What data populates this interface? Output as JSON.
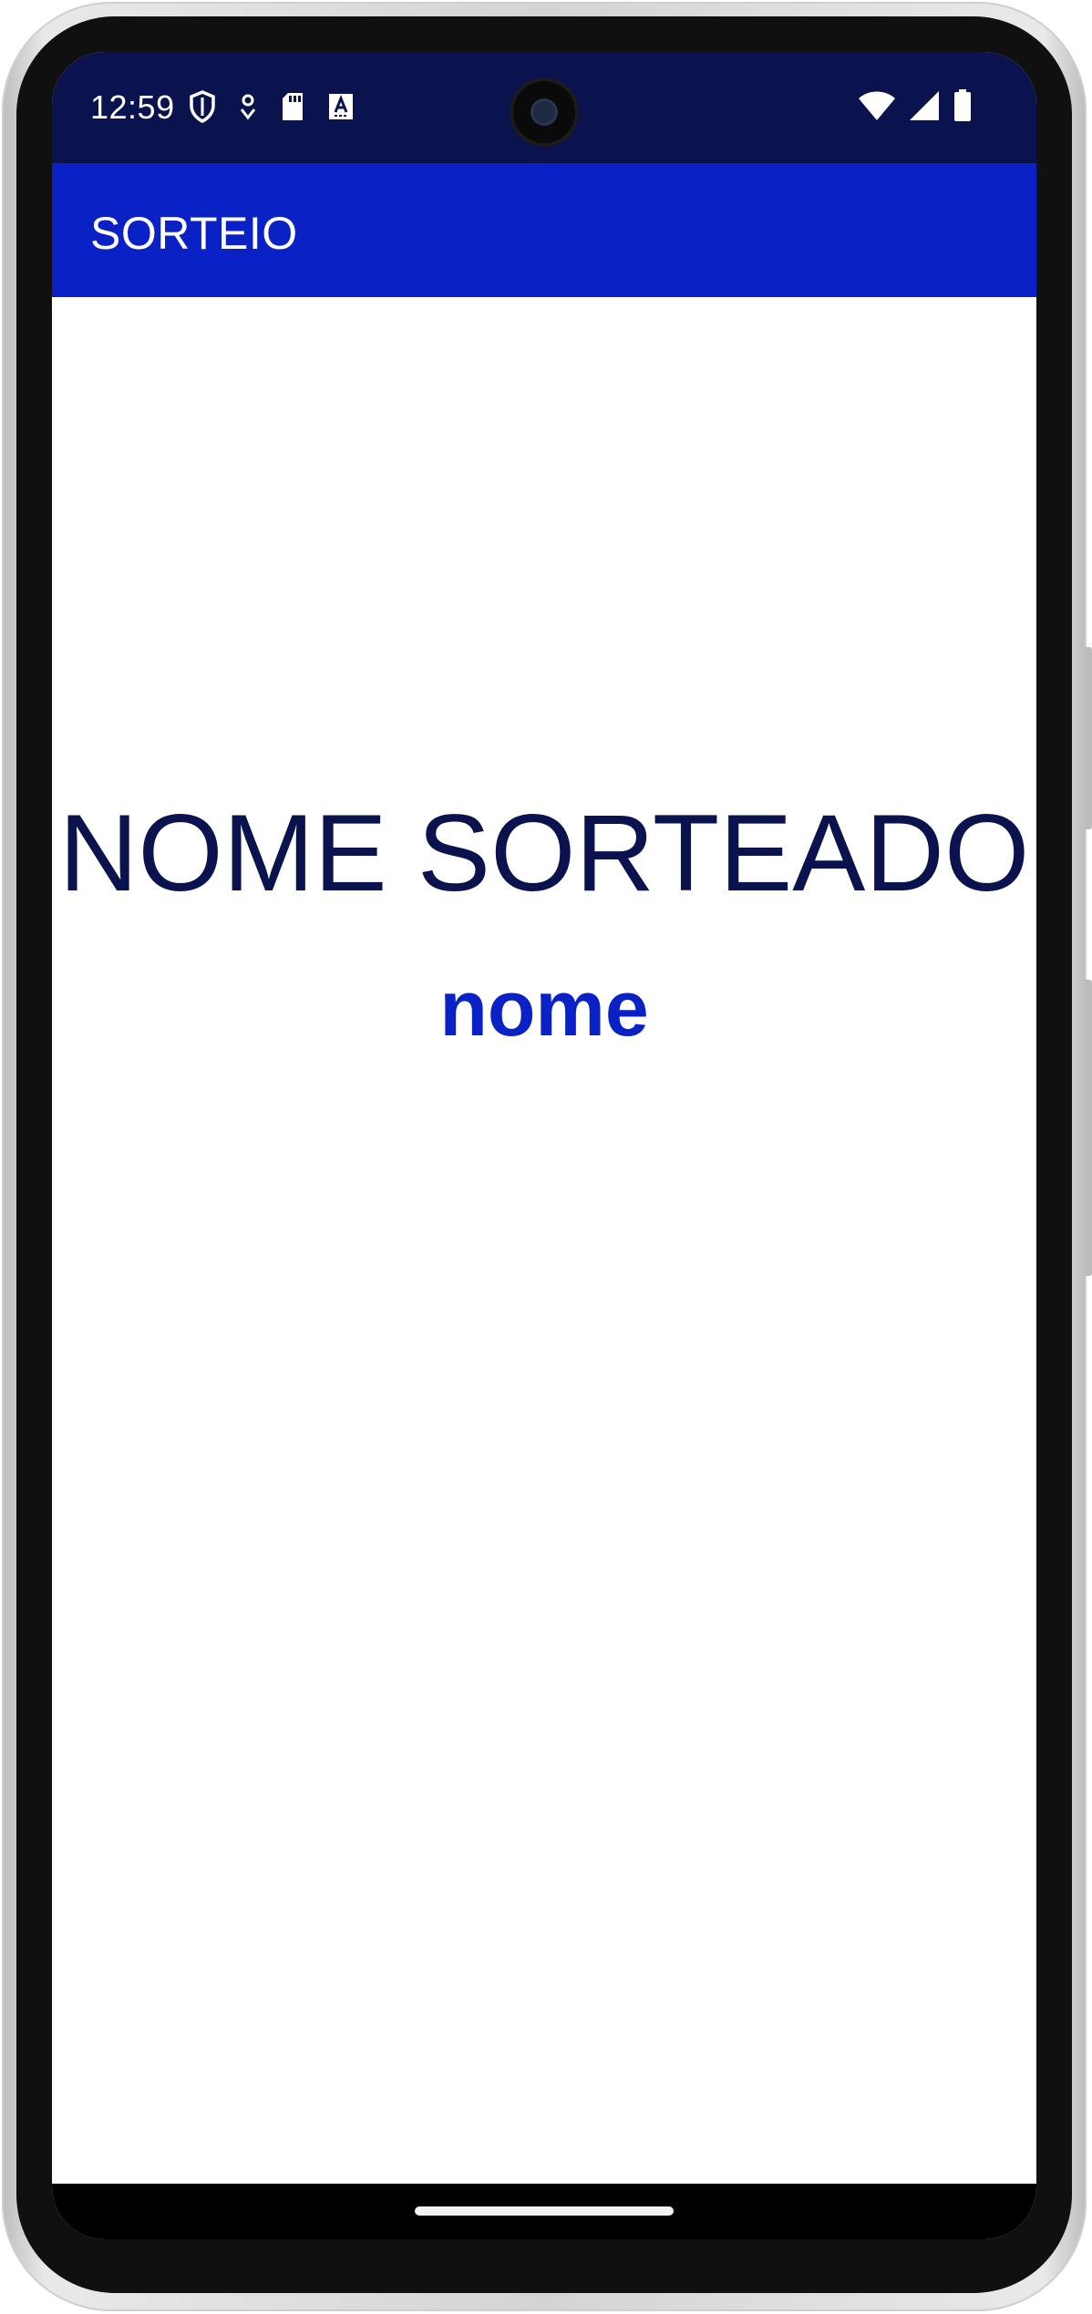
{
  "status_bar": {
    "time": "12:59",
    "left_icons": [
      "shield-icon",
      "location-pin-icon",
      "sd-card-icon",
      "font-a-icon"
    ],
    "right_icons": [
      "wifi-icon",
      "cellular-signal-icon",
      "battery-icon"
    ],
    "background": "#0b134f"
  },
  "app_bar": {
    "title": "SORTEIO",
    "background": "#0a21c6"
  },
  "main": {
    "heading": "NOME SORTEADO",
    "heading_color": "#0b134f",
    "result": "nome",
    "result_color": "#0a21c6"
  },
  "nav_bar": {
    "handle": "home-gesture-handle"
  }
}
